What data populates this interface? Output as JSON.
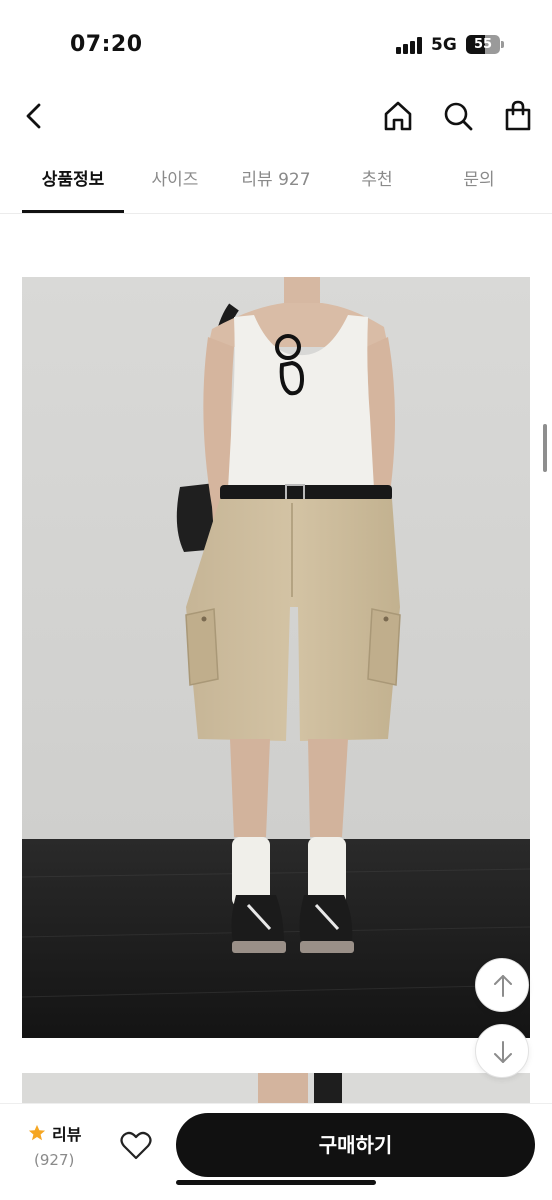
{
  "status_bar": {
    "time": "07:20",
    "network": "5G",
    "battery_level": "55",
    "battery_fraction": 0.55
  },
  "header": {
    "back_icon": "chevron-left-icon",
    "home_icon": "home-icon",
    "search_icon": "search-icon",
    "cart_icon": "shopping-bag-icon"
  },
  "tabs": [
    {
      "label": "상품정보",
      "active": true
    },
    {
      "label": "사이즈",
      "active": false
    },
    {
      "label": "리뷰 927",
      "active": false
    },
    {
      "label": "추천",
      "active": false
    },
    {
      "label": "문의",
      "active": false
    }
  ],
  "floating_buttons": {
    "scroll_top_icon": "arrow-up-icon",
    "scroll_down_icon": "arrow-down-icon"
  },
  "bottom_bar": {
    "review_label": "리뷰",
    "review_count": "(927)",
    "like_icon": "heart-icon",
    "buy_label": "구매하기"
  },
  "colors": {
    "accent": "#111111",
    "star": "#f5a623",
    "tab_inactive": "#8a8a8a"
  }
}
